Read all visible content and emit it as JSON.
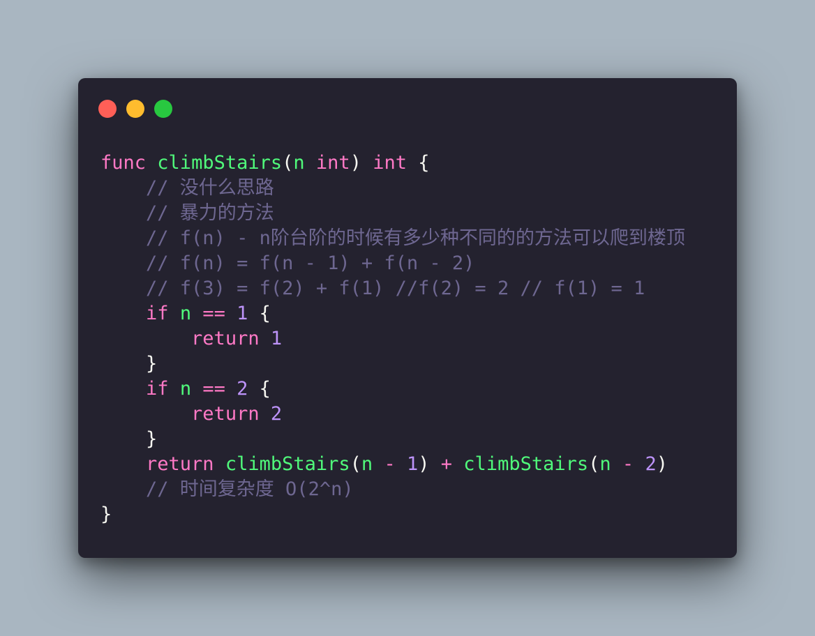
{
  "theme": {
    "background": "#a9b6c1",
    "window_bg": "#24222f",
    "dot_red": "#ff5f57",
    "dot_yellow": "#febc2e",
    "dot_green": "#28c840"
  },
  "token_colors": {
    "kw": "#ff79c6",
    "fn": "#50fa7b",
    "num": "#bd93f9",
    "cm": "#6e6791",
    "op": "#ff79c6",
    "plain": "#f8f8f2"
  },
  "code_lines": [
    [
      [
        "kw",
        "func"
      ],
      [
        "plain",
        " "
      ],
      [
        "fn",
        "climbStairs"
      ],
      [
        "plain",
        "("
      ],
      [
        "fn",
        "n"
      ],
      [
        "plain",
        " "
      ],
      [
        "kw",
        "int"
      ],
      [
        "plain",
        ") "
      ],
      [
        "kw",
        "int"
      ],
      [
        "plain",
        " {"
      ]
    ],
    [
      [
        "plain",
        "    "
      ],
      [
        "cm",
        "// 没什么思路"
      ]
    ],
    [
      [
        "plain",
        "    "
      ],
      [
        "cm",
        "// 暴力的方法"
      ]
    ],
    [
      [
        "plain",
        "    "
      ],
      [
        "cm",
        "// f(n) - n阶台阶的时候有多少种不同的的方法可以爬到楼顶"
      ]
    ],
    [
      [
        "plain",
        "    "
      ],
      [
        "cm",
        "// f(n) = f(n - 1) + f(n - 2)"
      ]
    ],
    [
      [
        "plain",
        "    "
      ],
      [
        "cm",
        "// f(3) = f(2) + f(1) //f(2) = 2 // f(1) = 1"
      ]
    ],
    [
      [
        "plain",
        "    "
      ],
      [
        "kw",
        "if"
      ],
      [
        "plain",
        " "
      ],
      [
        "fn",
        "n"
      ],
      [
        "plain",
        " "
      ],
      [
        "op",
        "=="
      ],
      [
        "plain",
        " "
      ],
      [
        "num",
        "1"
      ],
      [
        "plain",
        " {"
      ]
    ],
    [
      [
        "plain",
        "        "
      ],
      [
        "kw",
        "return"
      ],
      [
        "plain",
        " "
      ],
      [
        "num",
        "1"
      ]
    ],
    [
      [
        "plain",
        "    }"
      ]
    ],
    [
      [
        "plain",
        "    "
      ],
      [
        "kw",
        "if"
      ],
      [
        "plain",
        " "
      ],
      [
        "fn",
        "n"
      ],
      [
        "plain",
        " "
      ],
      [
        "op",
        "=="
      ],
      [
        "plain",
        " "
      ],
      [
        "num",
        "2"
      ],
      [
        "plain",
        " {"
      ]
    ],
    [
      [
        "plain",
        "        "
      ],
      [
        "kw",
        "return"
      ],
      [
        "plain",
        " "
      ],
      [
        "num",
        "2"
      ]
    ],
    [
      [
        "plain",
        "    }"
      ]
    ],
    [
      [
        "plain",
        "    "
      ],
      [
        "kw",
        "return"
      ],
      [
        "plain",
        " "
      ],
      [
        "fn",
        "climbStairs"
      ],
      [
        "plain",
        "("
      ],
      [
        "fn",
        "n"
      ],
      [
        "plain",
        " "
      ],
      [
        "op",
        "-"
      ],
      [
        "plain",
        " "
      ],
      [
        "num",
        "1"
      ],
      [
        "plain",
        ") "
      ],
      [
        "op",
        "+"
      ],
      [
        "plain",
        " "
      ],
      [
        "fn",
        "climbStairs"
      ],
      [
        "plain",
        "("
      ],
      [
        "fn",
        "n"
      ],
      [
        "plain",
        " "
      ],
      [
        "op",
        "-"
      ],
      [
        "plain",
        " "
      ],
      [
        "num",
        "2"
      ],
      [
        "plain",
        ")"
      ]
    ],
    [
      [
        "plain",
        "    "
      ],
      [
        "cm",
        "// 时间复杂度 O(2^n)"
      ]
    ],
    [
      [
        "plain",
        "}"
      ]
    ]
  ]
}
